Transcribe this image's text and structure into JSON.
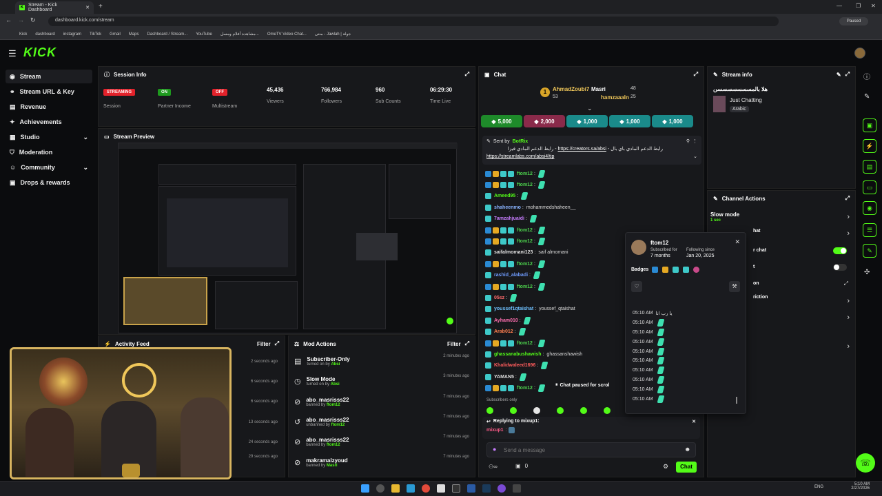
{
  "browser": {
    "tab_title": "Stream - Kick Dashboard",
    "url": "dashboard.kick.com/stream",
    "profile_label": "Paused",
    "bookmarks": [
      "Kick",
      "dashboard",
      "instagram",
      "TikTok",
      "Gmail",
      "Maps",
      "Dashboard / Stream...",
      "YouTube",
      "مشاهدة أفلام ومسل...",
      "OmeTV Video Chat...",
      "منتى - Jawlah | جولة"
    ]
  },
  "app": {
    "logo": "KICK"
  },
  "sidebar": {
    "items": [
      {
        "label": "Stream",
        "icon": "stream-icon"
      },
      {
        "label": "Stream URL & Key",
        "icon": "link-icon"
      },
      {
        "label": "Revenue",
        "icon": "revenue-icon"
      },
      {
        "label": "Achievements",
        "icon": "trophy-icon"
      },
      {
        "label": "Studio",
        "icon": "studio-icon"
      },
      {
        "label": "Moderation",
        "icon": "shield-icon"
      },
      {
        "label": "Community",
        "icon": "community-icon"
      },
      {
        "label": "Drops & rewards",
        "icon": "gift-icon"
      }
    ]
  },
  "session": {
    "title": "Session Info",
    "stats": [
      {
        "value": "STREAMING",
        "label": "Session"
      },
      {
        "value": "ON",
        "label": "Partner Income"
      },
      {
        "value": "OFF",
        "label": "Multistream"
      },
      {
        "value": "45,436",
        "label": "Viewers"
      },
      {
        "value": "766,984",
        "label": "Followers"
      },
      {
        "value": "960",
        "label": "Sub Counts"
      },
      {
        "value": "06:29:30",
        "label": "Time Live"
      }
    ]
  },
  "preview": {
    "title": "Stream Preview"
  },
  "activity": {
    "title": "Activity Feed",
    "filter_label": "Filter",
    "times": [
      "2 seconds ago",
      "6 seconds ago",
      "6 seconds ago",
      "13 seconds ago",
      "24 seconds ago",
      "29 seconds ago"
    ]
  },
  "mod_actions": {
    "title": "Mod Actions",
    "filter_label": "Filter",
    "rows": [
      {
        "action": "Subscriber-Only",
        "detail_prefix": "turned on by",
        "user": "Absi",
        "time": "2 minutes ago"
      },
      {
        "action": "Slow Mode",
        "detail_prefix": "turned on by",
        "user": "Absi",
        "time": "3 minutes ago"
      },
      {
        "action": "abo_masrisss22",
        "detail_prefix": "banned by",
        "user": "ftom12",
        "time": "7 minutes ago"
      },
      {
        "action": "abo_masrisss22",
        "detail_prefix": "unbanned by",
        "user": "ftom12",
        "time": "7 minutes ago"
      },
      {
        "action": "abo_masrisss22",
        "detail_prefix": "banned by",
        "user": "ftom12",
        "time": "7 minutes ago"
      },
      {
        "action": "makramalzyoud",
        "detail_prefix": "banned by",
        "user": "Masri",
        "time": "7 minutes ago"
      }
    ]
  },
  "chat": {
    "title": "Chat",
    "leader_1": {
      "name": "AhmadZoubi7",
      "count": "53",
      "rank": "1"
    },
    "leader_2": {
      "name": "Masri",
      "count": "48"
    },
    "leader_3": {
      "name": "hamzaaaln",
      "count": "25"
    },
    "gifts": [
      "5,000",
      "2,000",
      "1,000",
      "1,000",
      "1,000"
    ],
    "pinned": {
      "sent_by_label": "Sent by",
      "sender": "BotRix",
      "text": "رابط الدعم المادي باي بال - ",
      "link1": "https://creators.sa/absi",
      "text2": " - رابط الدعم المادي فيزا",
      "link2": "https://streamlabs.com/absi4/tip"
    },
    "messages": [
      {
        "user": "ftom12",
        "color": "#4dd34d",
        "text": ""
      },
      {
        "user": "ftom12",
        "color": "#4dd34d",
        "text": ""
      },
      {
        "user": "Ameed95",
        "color": "#53fc18",
        "text": ""
      },
      {
        "user": "shaheenmo",
        "color": "#8ab4ff",
        "text": "mohammedshaheen__"
      },
      {
        "user": "7amzahjuaidi",
        "color": "#c77dff",
        "text": ""
      },
      {
        "user": "ftom12",
        "color": "#4dd34d",
        "text": ""
      },
      {
        "user": "ftom12",
        "color": "#4dd34d",
        "text": ""
      },
      {
        "user": "saifalmomani123",
        "color": "#e0e0e0",
        "text": "saif almomani"
      },
      {
        "user": "ftom12",
        "color": "#4dd34d",
        "text": ""
      },
      {
        "user": "rashid_alabadi",
        "color": "#6f9cff",
        "text": ""
      },
      {
        "user": "ftom12",
        "color": "#4dd34d",
        "text": ""
      },
      {
        "user": "05sz",
        "color": "#ff6b6b",
        "text": ""
      },
      {
        "user": "youssef1qtaishat",
        "color": "#6ec0ff",
        "text": "youssef_qtaishat"
      },
      {
        "user": "Ayham010",
        "color": "#ff6fb0",
        "text": ""
      },
      {
        "user": "Arab012",
        "color": "#ff7f50",
        "text": ""
      },
      {
        "user": "ftom12",
        "color": "#4dd34d",
        "text": ""
      },
      {
        "user": "ghassanabushawish",
        "color": "#53fc18",
        "text": "ghassanshawish"
      },
      {
        "user": "Khalidwaleed1696",
        "color": "#ff5c5c",
        "text": ""
      },
      {
        "user": "YAMAN5",
        "color": "#e0e0e0",
        "text": ""
      },
      {
        "user": "ftom12",
        "color": "#4dd34d",
        "text": ""
      }
    ],
    "paused_label": "Chat paused for scrol",
    "subscribers_only": "Subscribers only",
    "replying_label": "Replying to mixup1:",
    "reply_user": "mixup1",
    "input_placeholder": "Send a message",
    "points": "0",
    "chat_button": "Chat"
  },
  "user_card": {
    "username": "ftom12",
    "subscribed_label": "Subscribed for",
    "subscribed_value": "7 months",
    "following_label": "Following since",
    "following_value": "Jan 20, 2025",
    "badges_label": "Badges",
    "history": [
      {
        "time": "05:10 AM",
        "text": "يا رب انا"
      },
      {
        "time": "05:10 AM",
        "text": ""
      },
      {
        "time": "05:10 AM",
        "text": ""
      },
      {
        "time": "05:10 AM",
        "text": ""
      },
      {
        "time": "05:10 AM",
        "text": ""
      },
      {
        "time": "05:10 AM",
        "text": ""
      },
      {
        "time": "05:10 AM",
        "text": ""
      },
      {
        "time": "05:10 AM",
        "text": ""
      },
      {
        "time": "05:10 AM",
        "text": ""
      },
      {
        "time": "05:10 AM",
        "text": ""
      }
    ]
  },
  "stream_info": {
    "title": "Stream info",
    "stream_title": "هلا بالمسسسسسسسن",
    "category": "Just Chatting",
    "language": "Arabic"
  },
  "channel_actions": {
    "title": "Channel Actions",
    "slow_mode_label": "Slow mode",
    "slow_mode_value": "1 sec",
    "row_fragments": [
      "hat",
      "r chat",
      "t",
      "on",
      "riction"
    ]
  },
  "taskbar": {
    "lang": "ENG",
    "time": "5:10 AM",
    "date": "2/27/2026"
  },
  "colors": {
    "accent": "#53fc18",
    "panel": "#17181b",
    "bg": "#0b0c0e"
  }
}
